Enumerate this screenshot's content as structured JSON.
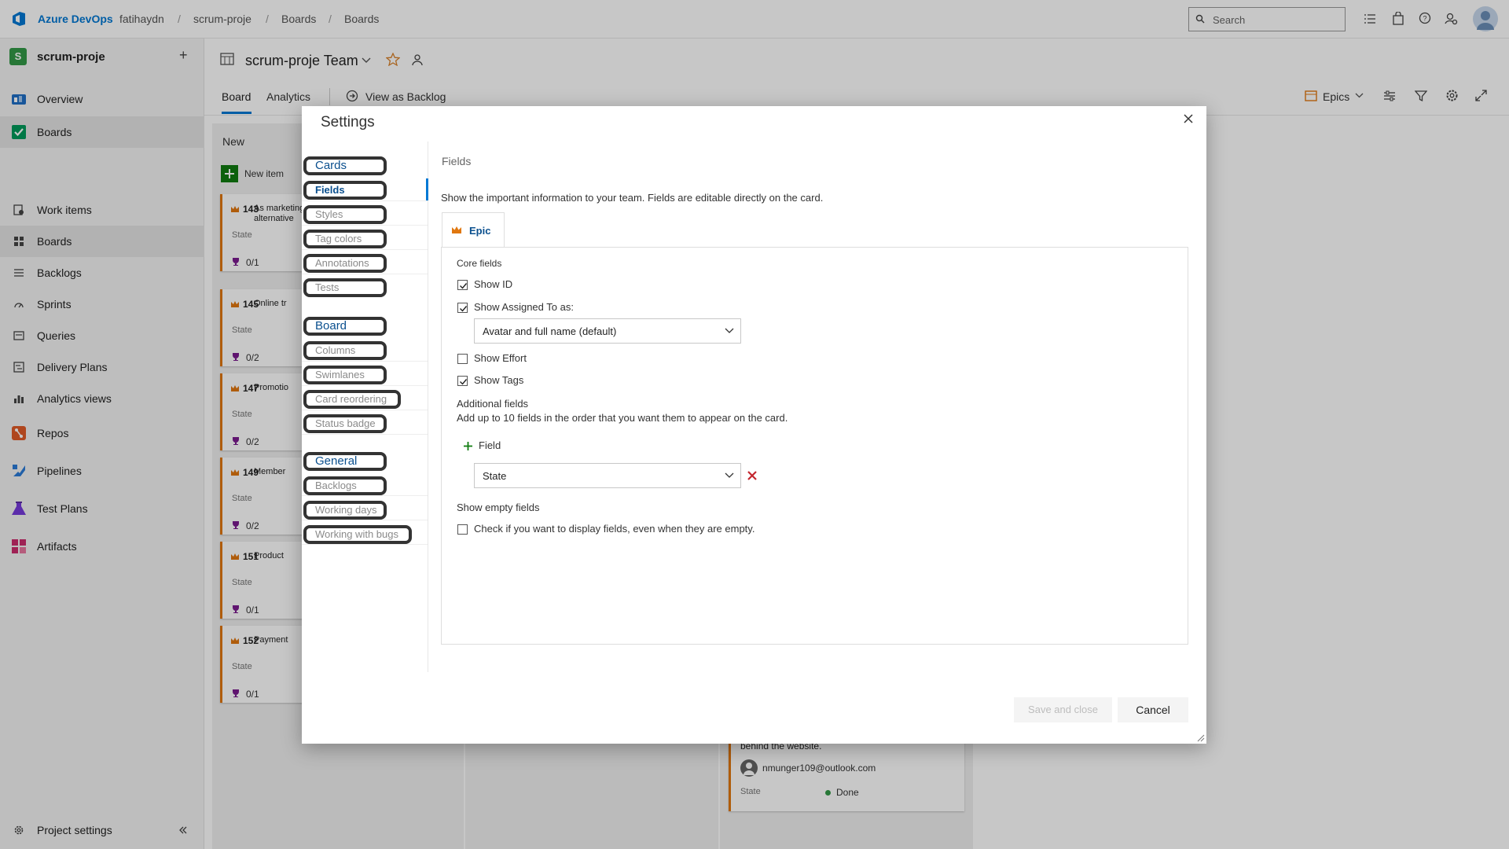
{
  "topbar": {
    "brand": "Azure DevOps",
    "breadcrumb": [
      "fatihaydn",
      "scrum-proje",
      "Boards",
      "Boards"
    ],
    "separator": "/",
    "search_placeholder": "Search"
  },
  "sidebar": {
    "project_initial": "S",
    "project_name": "scrum-proje",
    "add_label": "+",
    "items": [
      {
        "label": "Overview",
        "icon": "overview-icon"
      },
      {
        "label": "Boards",
        "icon": "boards-icon"
      },
      {
        "label": "Work items",
        "icon": "work-items-icon"
      },
      {
        "label": "Boards",
        "icon": "board-icon"
      },
      {
        "label": "Backlogs",
        "icon": "backlogs-icon"
      },
      {
        "label": "Sprints",
        "icon": "sprints-icon"
      },
      {
        "label": "Queries",
        "icon": "queries-icon"
      },
      {
        "label": "Delivery Plans",
        "icon": "delivery-plans-icon"
      },
      {
        "label": "Analytics views",
        "icon": "analytics-icon"
      },
      {
        "label": "Repos",
        "icon": "repos-icon"
      },
      {
        "label": "Pipelines",
        "icon": "pipelines-icon"
      },
      {
        "label": "Test Plans",
        "icon": "test-plans-icon"
      },
      {
        "label": "Artifacts",
        "icon": "artifacts-icon"
      }
    ],
    "footer": "Project settings"
  },
  "board": {
    "team_title": "scrum-proje Team",
    "tabs": [
      "Board",
      "Analytics"
    ],
    "view_backlog": "View as Backlog",
    "level": "Epics",
    "column_new": "New",
    "new_item": "New item",
    "cards": [
      {
        "id": "143",
        "title": "As marketing, alternative Web S",
        "state": "State",
        "progress": "0/1"
      },
      {
        "id": "145",
        "title": "Online tr",
        "state": "State",
        "progress": "0/2"
      },
      {
        "id": "147",
        "title": "Promotio",
        "state": "State",
        "progress": "0/2"
      },
      {
        "id": "149",
        "title": "Member",
        "state": "State",
        "progress": "0/2"
      },
      {
        "id": "151",
        "title": "Product",
        "state": "State",
        "progress": "0/1"
      },
      {
        "id": "152",
        "title": "Payment",
        "state": "State",
        "progress": "0/1"
      }
    ],
    "bg_card": {
      "text": "behind the website.",
      "assignee": "nmunger109@outlook.com",
      "state_label": "State",
      "state_value": "Done"
    }
  },
  "dialog": {
    "title": "Settings",
    "nav": [
      {
        "label": "Cards",
        "group": true
      },
      {
        "label": "Fields",
        "selected": true
      },
      {
        "label": "Styles"
      },
      {
        "label": "Tag colors"
      },
      {
        "label": "Annotations"
      },
      {
        "label": "Tests"
      },
      {
        "label": "Board",
        "group": true
      },
      {
        "label": "Columns"
      },
      {
        "label": "Swimlanes"
      },
      {
        "label": "Card reordering"
      },
      {
        "label": "Status badge"
      },
      {
        "label": "General",
        "group": true
      },
      {
        "label": "Backlogs"
      },
      {
        "label": "Working days"
      },
      {
        "label": "Working with bugs"
      }
    ],
    "section_title": "Fields",
    "description": "Show the important information to your team. Fields are editable directly on the card.",
    "tab": "Epic",
    "core_fields_label": "Core fields",
    "show_id": {
      "label": "Show ID",
      "checked": true
    },
    "show_assigned": {
      "label": "Show Assigned To as:",
      "checked": true
    },
    "assigned_option": "Avatar and full name (default)",
    "show_effort": {
      "label": "Show Effort",
      "checked": false
    },
    "show_tags": {
      "label": "Show Tags",
      "checked": true
    },
    "additional_label": "Additional fields",
    "additional_desc": "Add up to 10 fields in the order that you want them to appear on the card.",
    "add_field": "Field",
    "field_value": "State",
    "empty_label": "Show empty fields",
    "empty_check": {
      "label": "Check if you want to display fields, even when they are empty.",
      "checked": false
    },
    "save_button": "Save and close",
    "cancel_button": "Cancel"
  }
}
